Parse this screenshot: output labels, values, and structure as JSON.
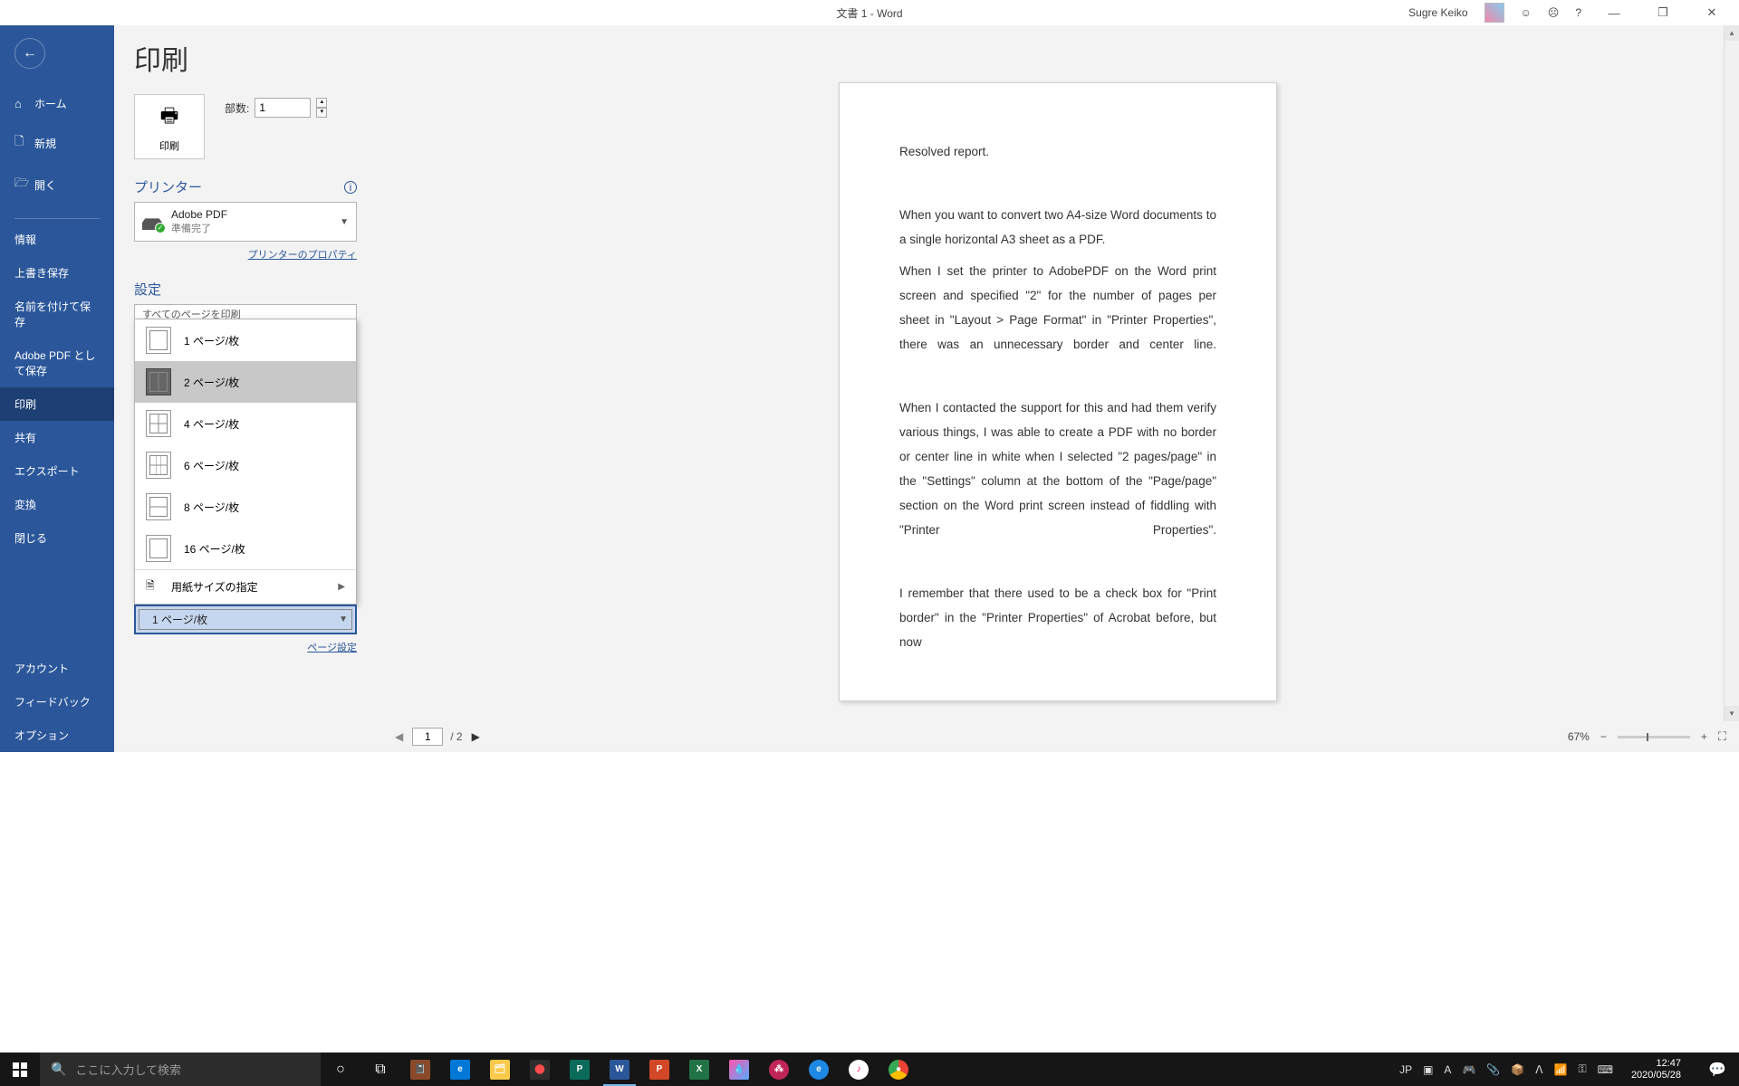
{
  "title": "文書 1  -  Word",
  "user": "Sugre Keiko",
  "sidebar": {
    "home": "ホーム",
    "new": "新規",
    "open": "開く",
    "info": "情報",
    "save": "上書き保存",
    "saveas": "名前を付けて保存",
    "adobe": "Adobe PDF として保存",
    "print": "印刷",
    "share": "共有",
    "export": "エクスポート",
    "transform": "変換",
    "close": "閉じる",
    "account": "アカウント",
    "feedback": "フィードバック",
    "options": "オプション"
  },
  "print": {
    "title": "印刷",
    "button": "印刷",
    "copies_label": "部数:",
    "copies_value": "1",
    "printer_hdr": "プリンター",
    "printer_name": "Adobe PDF",
    "printer_status": "準備完了",
    "printer_props": "プリンターのプロパティ",
    "settings_hdr": "設定",
    "cutoff_text": "すべてのページを印刷",
    "pages_options": [
      "1 ページ/枚",
      "2 ページ/枚",
      "4 ページ/枚",
      "6 ページ/枚",
      "8 ページ/枚",
      "16 ページ/枚"
    ],
    "paper_size": "用紙サイズの指定",
    "selected": "1 ページ/枚",
    "page_setup": "ページ設定"
  },
  "doc": {
    "p1": "Resolved report.",
    "p2": "When you want to convert two A4-size Word documents to a single horizontal A3 sheet as a PDF.",
    "p3": "When I set the printer to AdobePDF on the Word print screen and specified \"2\" for the number of pages per sheet in \"Layout > Page Format\" in \"Printer Properties\", there was an unnecessary border and center line.",
    "p4": "When I contacted the support for this and had them verify various things, I was able to create a PDF with no border or center line in white when I selected \"2 pages/page\" in the \"Settings\" column at the bottom of the \"Page/page\" section on the Word print screen instead of fiddling with \"Printer Properties\".",
    "p5": "I remember that there used to be a check box for \"Print border\" in the \"Printer Properties\" of Acrobat before, but now"
  },
  "preview": {
    "page": "1",
    "total": "/ 2",
    "zoom": "67%"
  },
  "taskbar": {
    "search_placeholder": "ここに入力して検索",
    "ime": "JP",
    "time": "12:47",
    "date": "2020/05/28"
  }
}
